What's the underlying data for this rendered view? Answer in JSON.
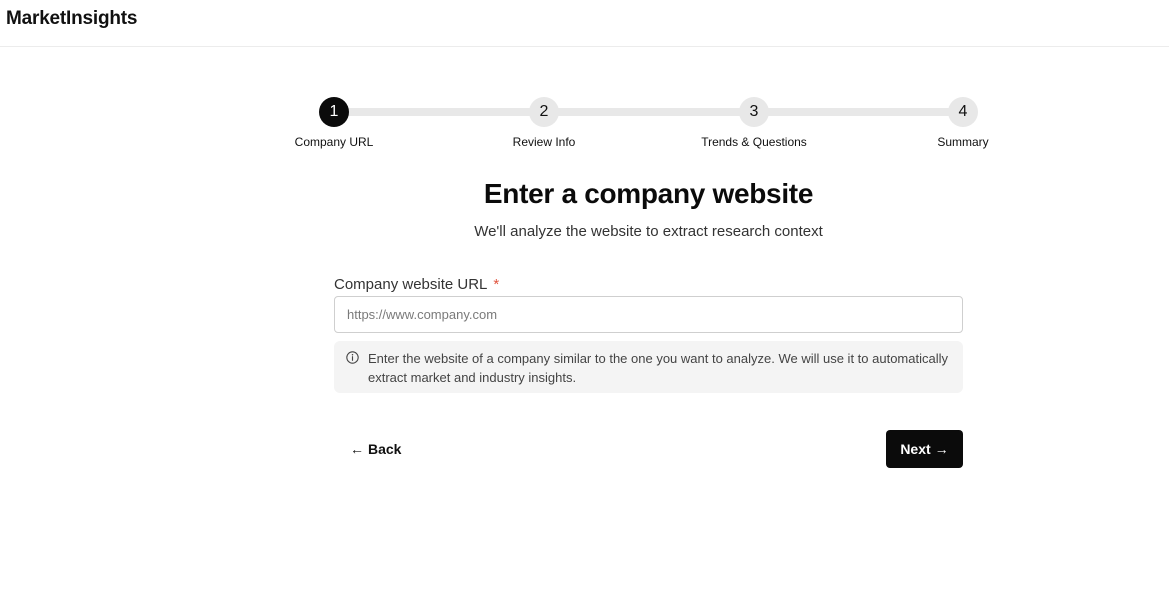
{
  "app": {
    "brand": "MarketInsights"
  },
  "stepper": {
    "steps": [
      {
        "number": "1",
        "label": "Company URL",
        "state": "active"
      },
      {
        "number": "2",
        "label": "Review Info",
        "state": "inactive"
      },
      {
        "number": "3",
        "label": "Trends & Questions",
        "state": "inactive"
      },
      {
        "number": "4",
        "label": "Summary",
        "state": "inactive"
      }
    ]
  },
  "main": {
    "title": "Enter a company website",
    "subtitle": "We'll analyze the website to extract research context",
    "field": {
      "label": "Company website URL",
      "required_mark": "*",
      "value": "",
      "placeholder": "https://www.company.com"
    },
    "helper": {
      "icon": "info-icon",
      "text": "Enter the website of a company similar to the one you want to analyze. We will use it to automatically extract market and industry insights."
    }
  },
  "actions": {
    "back_arrow": "←",
    "back_label": "Back",
    "next_label": "Next",
    "next_arrow": "→"
  },
  "colors": {
    "accent": "#0b0b0b",
    "required": "#e0533d",
    "track": "#e8e8e8",
    "helper_bg": "#f4f4f4"
  }
}
